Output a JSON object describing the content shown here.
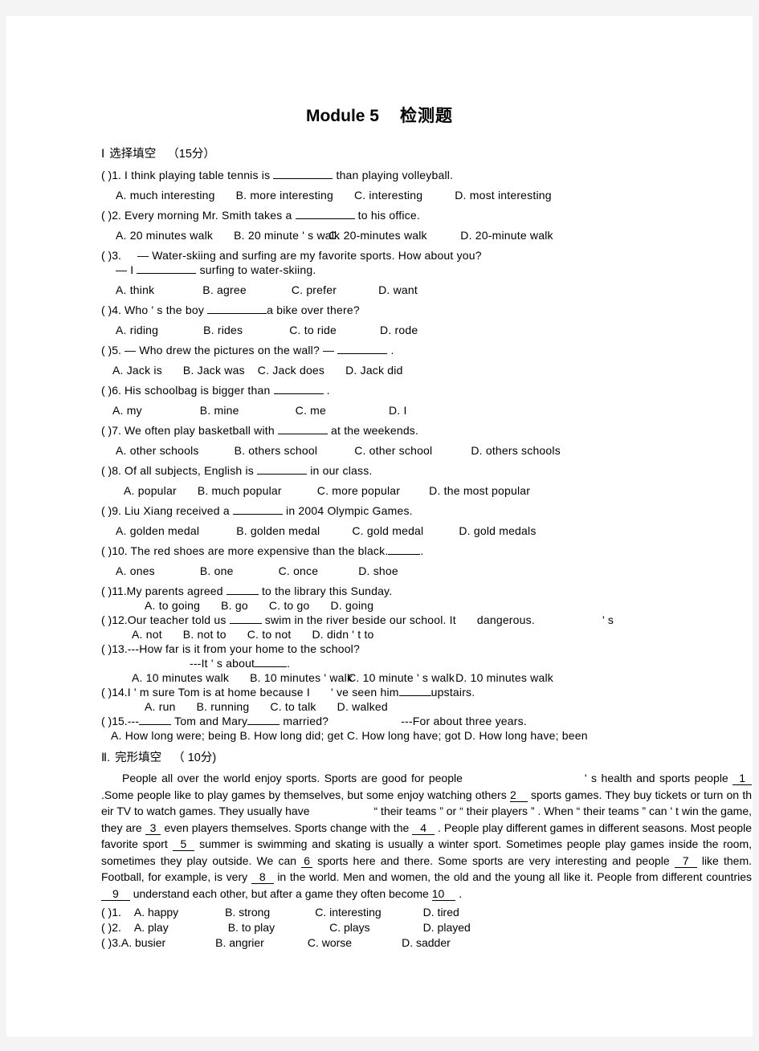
{
  "document": {
    "title_main": "Module 5",
    "title_cn": "检测题"
  },
  "section1": {
    "numeral": "Ⅰ",
    "name": "选择填空",
    "points": "（15分）",
    "questions": [
      {
        "mark": "(    )1.",
        "stem_a": "I think playing table tennis is",
        "stem_b": "than playing volleyball.",
        "options": [
          "A. much interesting",
          "B. more interesting",
          "C. interesting",
          "D. most interesting"
        ]
      },
      {
        "mark": "(    )2.",
        "stem_a": "Every morning Mr. Smith takes a",
        "stem_b": "to his office.",
        "options": [
          "A. 20 minutes walk",
          "B. 20 minute ' s walk",
          "C. 20-minutes walk",
          "D. 20-minute walk"
        ]
      },
      {
        "mark": "(    )3.",
        "stem_a": "— Water-skiing and surfing are my favorite sports. How about you?",
        "stem_b": "— I",
        "stem_c": "surfing to water-skiing.",
        "options": [
          "A. think",
          "B. agree",
          "C. prefer",
          "D. want"
        ]
      },
      {
        "mark": "(    )4.",
        "stem_a": "Who ' s the boy",
        "stem_b": "a bike over there?",
        "options": [
          "A. riding",
          "B. rides",
          "C. to ride",
          "D. rode"
        ]
      },
      {
        "mark": "(    )5.",
        "stem_a": "— Who drew the pictures on the wall?   —",
        "stem_b": ".",
        "options": [
          "A. Jack is",
          "B. Jack was",
          "C. Jack does",
          "D. Jack did"
        ]
      },
      {
        "mark": "(    )6.",
        "stem_a": "His schoolbag is bigger than",
        "stem_b": ".",
        "options": [
          "A. my",
          "B. mine",
          "C. me",
          "D. I"
        ]
      },
      {
        "mark": "(    )7.",
        "stem_a": "We often play basketball with",
        "stem_b": "at the weekends.",
        "options": [
          "A. other schools",
          "B. others school",
          "C. other school",
          "D. others schools"
        ]
      },
      {
        "mark": "(    )8.",
        "stem_a": "Of all subjects, English is",
        "stem_b": "in our class.",
        "options": [
          "A. popular",
          "B. much popular",
          "C. more popular",
          "D. the most popular"
        ]
      },
      {
        "mark": "(    )9.",
        "stem_a": "Liu Xiang received a",
        "stem_b": "in 2004 Olympic Games.",
        "options": [
          "A. golden medal",
          "B. golden medal",
          "C. gold medal",
          "D. gold medals"
        ]
      },
      {
        "mark": "(    )10.",
        "stem_a": "The red shoes are more expensive than the black.",
        "stem_b": ".",
        "options": [
          "A. ones",
          "B. one",
          "C. once",
          "D. shoe"
        ]
      },
      {
        "mark": "(    )11.",
        "stem_a": "My parents agreed",
        "stem_b": "to the library this Sunday.",
        "options": [
          "A. to going",
          "B. go",
          "C. to go",
          "D. going"
        ]
      },
      {
        "mark": "(    )12.",
        "stem_a": "Our teacher told us",
        "stem_b": "swim in the river beside our school. It",
        "stem_c": "dangerous.",
        "stem_d": "' s",
        "options": [
          "A. not",
          "B. not to",
          "C. to not",
          "D. didn ' t to"
        ]
      },
      {
        "mark": "(    )13.",
        "stem_a": "---How far is it from your home to the school?",
        "stem_b": "---It ' s about",
        "stem_c": ".",
        "options": [
          "A. 10 minutes walk",
          "B. 10 minutes ' walk",
          "C. 10 minute ' s walk",
          "D. 10 minutes walk"
        ]
      },
      {
        "mark": "(    )14.",
        "stem_a": "I ' m sure Tom is at home because I",
        "stem_b": "' ve seen him",
        "stem_c": "upstairs.",
        "options": [
          "A. run",
          "B. running",
          "C. to talk",
          "D. walked"
        ]
      },
      {
        "mark": "(    )15.",
        "stem_a": "---",
        "stem_b": "Tom and Mary",
        "stem_c": "married?",
        "stem_d": "---For about three years.",
        "options_line": "A. How long were; being B. How long did; get C. How long have; got D. How long have; been"
      }
    ]
  },
  "section2": {
    "numeral": "Ⅱ",
    "dot": ".",
    "name": "完形填空",
    "points": "（ 10分)",
    "passage": {
      "p1": "People all over the world enjoy sports. Sports are good for people",
      "p2": "' s health and sports",
      "p3": "people",
      "blank1": "1",
      "p4": ".Some people like to play games by themselves, but some enjoy watching  others",
      "blank2": "2",
      "p5": "sports games. They buy tickets or turn on th eir TV to watch games. They usually have",
      "p6": "“ their teams ”  or  “ their players  ” . When  “ their teams   ”  can ' t win the game, they are",
      "blank3": "3",
      "p7": "even players themselves. Sports change with the",
      "blank4": "4",
      "p8": ". People play different  games in different seasons. Most people  favorite sport",
      "blank5": "5",
      "p9": "summer is swimming and skating is usually a winter sport. Sometimes people play games inside the room, sometimes they play outside. We can",
      "blank6": "6",
      "p10": "sports here and there. Some sports are very interesting and people",
      "blank7": "7",
      "p11": "like them. Football, for example, is very",
      "blank8": "8",
      "p12": "in the world. Men and women, the old and the young all like it. People from different countries",
      "blank9": "9",
      "p13": "understand each other, but after a game they often become",
      "blank10": "10",
      "p14": "."
    },
    "cloze_questions": [
      {
        "mark": "(        )1.",
        "options": [
          "A. happy",
          "B. strong",
          "C. interesting",
          "D. tired"
        ]
      },
      {
        "mark": "(        )2.",
        "options": [
          "A. play",
          "B. to play",
          "C. plays",
          "D. played"
        ]
      },
      {
        "mark": "(        )3.",
        "options": [
          "A. busier",
          "B. angrier",
          "C. worse",
          "D. sadder"
        ]
      }
    ]
  }
}
